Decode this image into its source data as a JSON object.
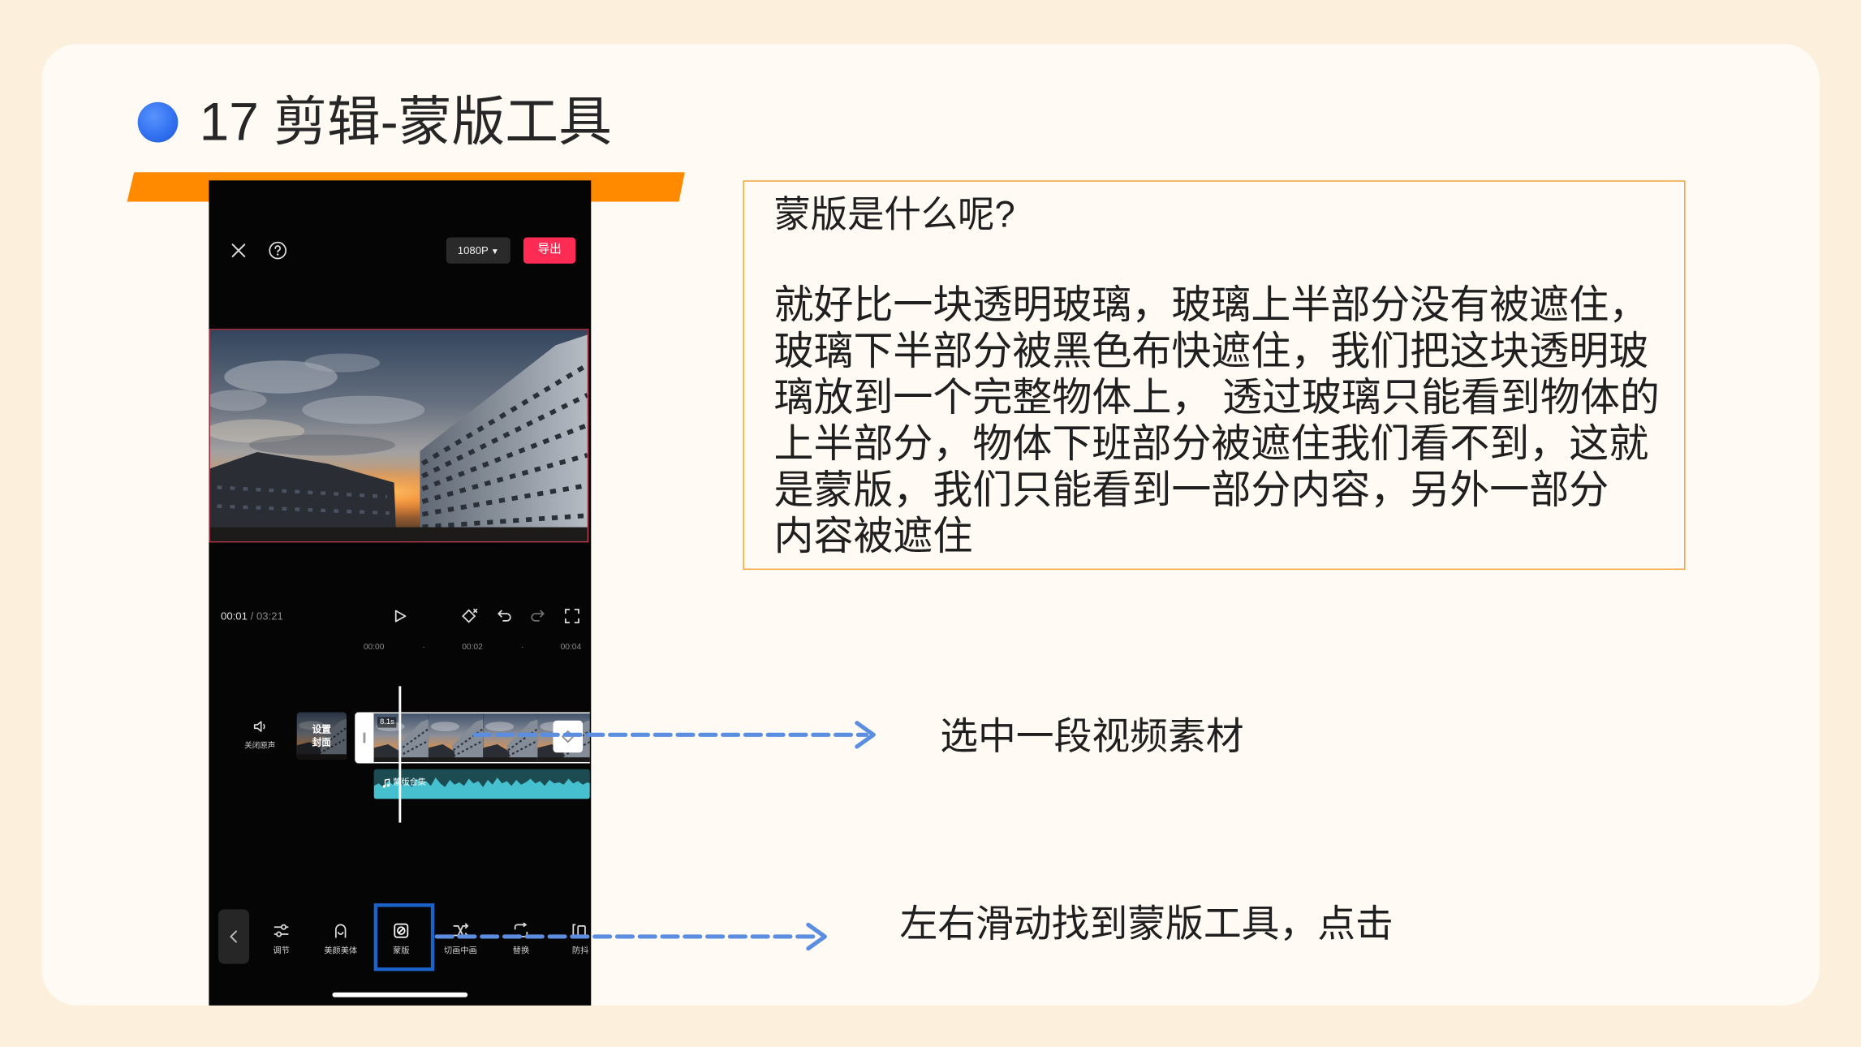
{
  "slide": {
    "title": "17 剪辑-蒙版工具"
  },
  "phone": {
    "top_bar": {
      "resolution": "1080P",
      "resolution_icon": "chevron-down-icon",
      "export_label": "导出"
    },
    "player": {
      "current_time": "00:01",
      "total_time": "/ 03:21"
    },
    "ruler": [
      "00:00",
      "·",
      "00:02",
      "·",
      "00:04"
    ],
    "track": {
      "mute_label": "关闭原声",
      "cover_label_lines": [
        "设置",
        "封面"
      ],
      "clip_duration": "8.1s",
      "audio_label": "蒙版合集"
    },
    "toolbar": {
      "items": [
        {
          "label": "调节",
          "icon": "adjust-icon"
        },
        {
          "label": "美颜美体",
          "icon": "beauty-icon"
        },
        {
          "label": "蒙版",
          "icon": "mask-icon",
          "selected": true
        },
        {
          "label": "切画中画",
          "icon": "pip-icon"
        },
        {
          "label": "替换",
          "icon": "replace-icon"
        },
        {
          "label": "防抖",
          "icon": "stabilize-icon"
        }
      ]
    }
  },
  "info_box": {
    "question": "蒙版是什么呢?",
    "lines": [
      "就好比一块透明玻璃，玻璃上半部分没有被遮住，",
      "玻璃下半部分被黑色布快遮住，我们把这块透明玻",
      "璃放到一个完整物体上， 透过玻璃只能看到物体的",
      "上半部分，物体下班部分被遮住我们看不到，这就",
      "是蒙版，我们只能看到一部分内容，另外一部分",
      "内容被遮住"
    ]
  },
  "annotations": {
    "select_clip": "选中一段视频素材",
    "find_mask_tool": "左右滑动找到蒙版工具，点击"
  },
  "colors": {
    "page_bg": "#fcefdc",
    "card_bg": "#fffaf3",
    "accent_blue": "#2f6fef",
    "bar_orange": "#ff8a00",
    "arrow_blue": "#5b8ee0",
    "highlight_blue": "#1c63c9",
    "export_red": "#fe2c55",
    "audio_teal": "#46c0cf",
    "box_border": "#f2a33a"
  }
}
